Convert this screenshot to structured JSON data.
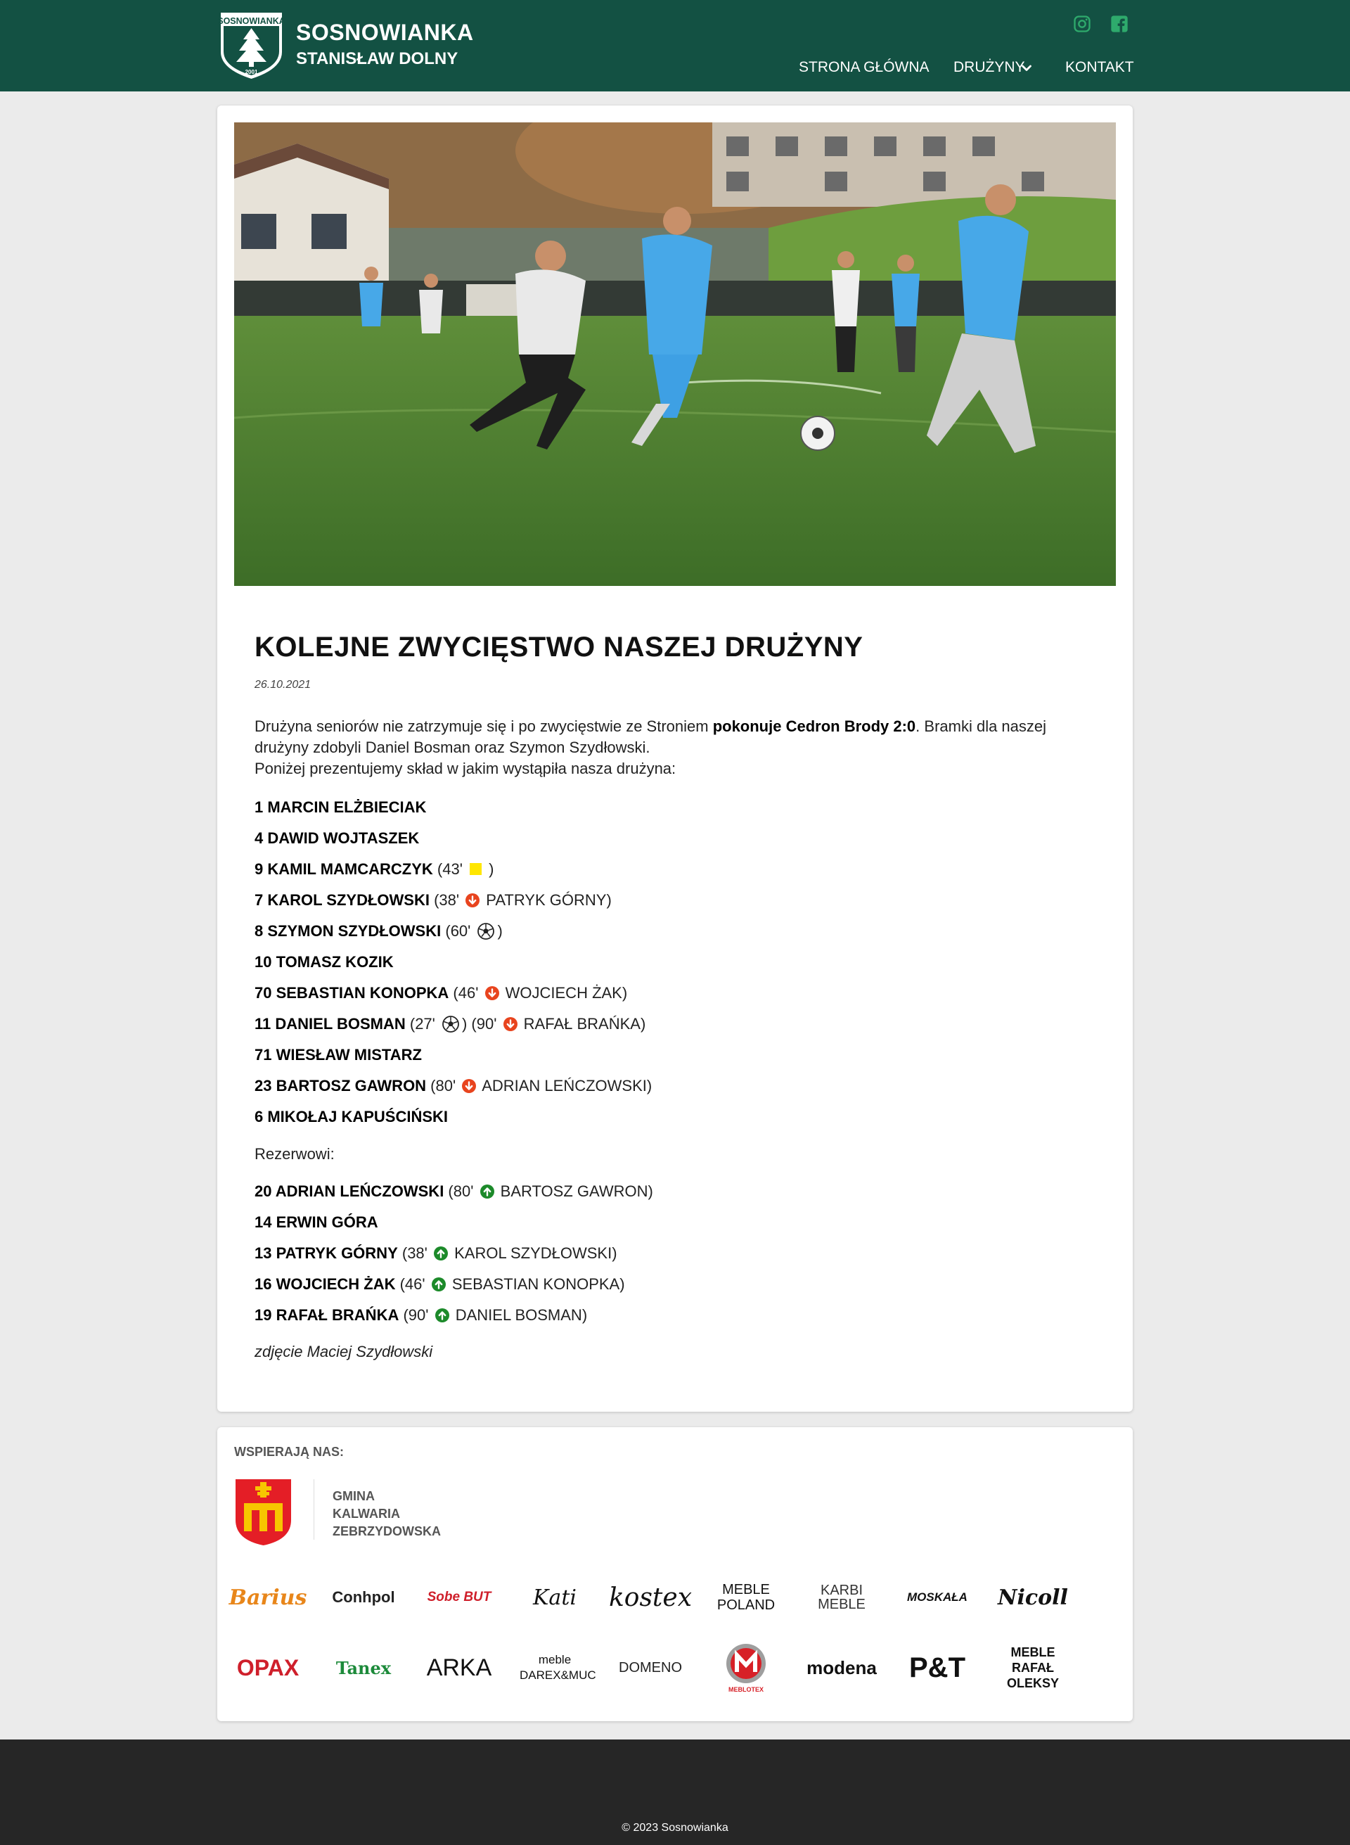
{
  "header": {
    "logo_text": "SOSNOWIANKA",
    "logo_year": "2001",
    "brand_line1": "SOSNOWIANKA",
    "brand_line2": "STANISŁAW DOLNY",
    "social_icons": [
      "instagram-icon",
      "facebook-icon"
    ],
    "nav": {
      "home": "STRONA GŁÓWNA",
      "teams": "DRUŻYNY",
      "contact": "KONTAKT"
    }
  },
  "article": {
    "title": "KOLEJNE ZWYCIĘSTWO NASZEJ DRUŻYNY",
    "date": "26.10.2021",
    "intro_a": "Drużyna seniorów nie zatrzymuje się i po zwycięstwie ze Stroniem ",
    "intro_bold": "pokonuje Cedron Brody 2:0",
    "intro_b": ". Bramki dla naszej drużyny zdobyli Daniel Bosman oraz Szymon Szydłowski.",
    "intro_2": "Poniżej prezentujemy skład w jakim wystąpiła nasza drużyna:",
    "starters": [
      {
        "name": "1 MARCIN ELŻBIECIAK"
      },
      {
        "name": "4 DAWID WOJTASZEK"
      },
      {
        "name": "9 KAMIL MAMCARCZYK",
        "card_pre": " (43' ",
        "card_post": " )"
      },
      {
        "name": "7 KAROL SZYDŁOWSKI",
        "sub_pre": " (38' ",
        "sub_post": " PATRYK GÓRNY)"
      },
      {
        "name": "8 SZYMON SZYDŁOWSKI",
        "goal_pre": " (60' ",
        "goal_post": ")"
      },
      {
        "name": "10 TOMASZ KOZIK"
      },
      {
        "name": "70 SEBASTIAN KONOPKA",
        "sub_pre": " (46' ",
        "sub_post": " WOJCIECH ŻAK)"
      },
      {
        "name": "11 DANIEL BOSMAN",
        "goal_pre": " (27' ",
        "goal_post": ") (90' ",
        "sub_post": " RAFAŁ BRAŃKA)"
      },
      {
        "name": "71 WIESŁAW MISTARZ"
      },
      {
        "name": "23 BARTOSZ GAWRON",
        "sub_pre": " (80' ",
        "sub_post": " ADRIAN LEŃCZOWSKI)"
      },
      {
        "name": "6 MIKOŁAJ KAPUŚCIŃSKI"
      }
    ],
    "reserves_label": "Rezerwowi:",
    "reserves": [
      {
        "name": "20 ADRIAN LEŃCZOWSKI",
        "sub_pre": " (80' ",
        "sub_post": " BARTOSZ GAWRON)"
      },
      {
        "name": "14 ERWIN GÓRA"
      },
      {
        "name": "13 PATRYK GÓRNY",
        "sub_pre": " (38' ",
        "sub_post": " KAROL SZYDŁOWSKI)"
      },
      {
        "name": "16 WOJCIECH ŻAK",
        "sub_pre": " (46' ",
        "sub_post": " SEBASTIAN KONOPKA)"
      },
      {
        "name": "19 RAFAŁ BRAŃKA",
        "sub_pre": " (90' ",
        "sub_post": " DANIEL BOSMAN)"
      }
    ],
    "photo_credit": "zdjęcie Maciej Szydłowski"
  },
  "sponsors": {
    "title": "WSPIERAJĄ NAS:",
    "gmina": [
      "GMINA",
      "KALWARIA",
      "ZEBRZYDOWSKA"
    ],
    "row1": [
      "Barius",
      "Conhpol",
      "Sobe BUT",
      "Kati",
      "kostex",
      "MEBLE POLAND",
      "KARBI MEBLE",
      "MOSKAŁA",
      "Nicoll"
    ],
    "row2": [
      "OPAX",
      "Tanex",
      "ARKA",
      "meble DAREX&MUC",
      "DOMENO",
      "MEBLOTEX",
      "modena",
      "P&T",
      "MEBLE RAFAŁ OLEKSY"
    ]
  },
  "footer": {
    "copyright": "© 2023 Sosnowianka"
  },
  "colors": {
    "header_bg": "#135143",
    "accent_green": "#2eaa6c",
    "sub_out": "#e8441e",
    "sub_in": "#1c8a2a",
    "yellow_card": "#ffe600"
  }
}
